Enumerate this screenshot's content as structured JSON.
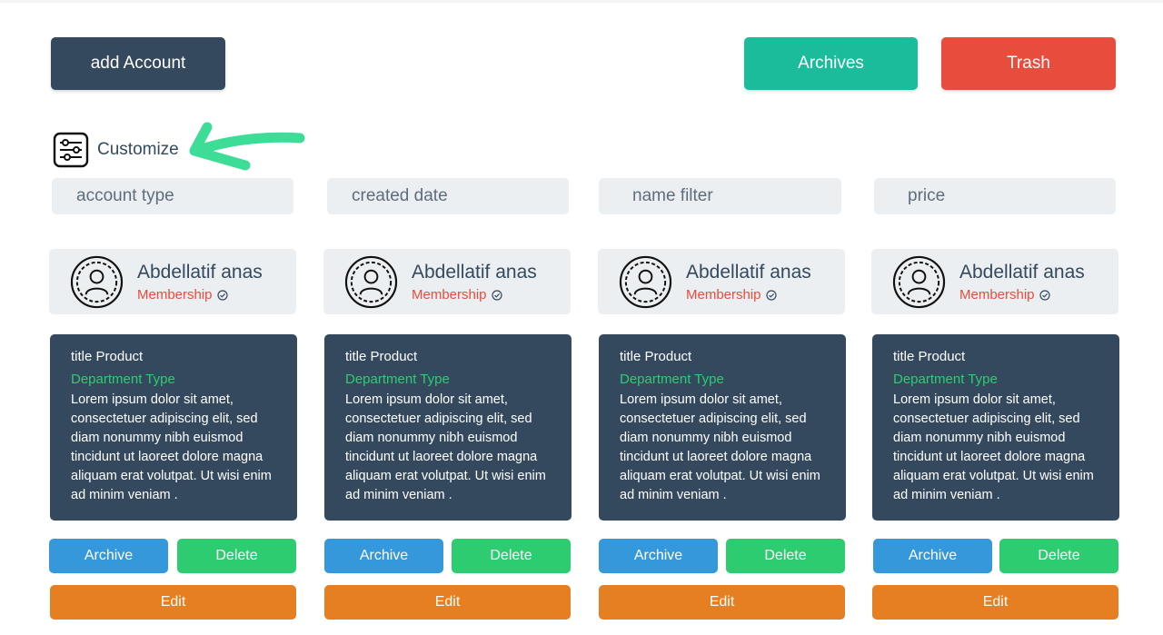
{
  "toolbar": {
    "add_account_label": "add Account",
    "archives_label": "Archives",
    "trash_label": "Trash"
  },
  "customize": {
    "label": "Customize",
    "icon": "sliders-icon"
  },
  "filters": [
    {
      "label": "account type"
    },
    {
      "label": "created date"
    },
    {
      "label": "name filter"
    },
    {
      "label": "price"
    }
  ],
  "cards": [
    {
      "name": "Abdellatif anas",
      "membership": "Membership",
      "title": "title Product",
      "department": "Department Type",
      "description": "Lorem ipsum dolor sit amet, consectetuer adipiscing elit, sed diam nonummy nibh euismod tincidunt ut laoreet dolore magna aliquam erat volutpat. Ut wisi enim ad minim veniam .",
      "archive_label": "Archive",
      "delete_label": "Delete",
      "edit_label": "Edit"
    },
    {
      "name": "Abdellatif anas",
      "membership": "Membership",
      "title": "title Product",
      "department": "Department Type",
      "description": "Lorem ipsum dolor sit amet, consectetuer adipiscing elit, sed diam nonummy nibh euismod tincidunt ut laoreet dolore magna aliquam erat volutpat. Ut wisi enim ad minim veniam .",
      "archive_label": "Archive",
      "delete_label": "Delete",
      "edit_label": "Edit"
    },
    {
      "name": "Abdellatif anas",
      "membership": "Membership",
      "title": "title Product",
      "department": "Department Type",
      "description": "Lorem ipsum dolor sit amet, consectetuer adipiscing elit, sed diam nonummy nibh euismod tincidunt ut laoreet dolore magna aliquam erat volutpat. Ut wisi enim ad minim veniam .",
      "archive_label": "Archive",
      "delete_label": "Delete",
      "edit_label": "Edit"
    },
    {
      "name": "Abdellatif anas",
      "membership": "Membership",
      "title": "title Product",
      "department": "Department Type",
      "description": "Lorem ipsum dolor sit amet, consectetuer adipiscing elit, sed diam nonummy nibh euismod tincidunt ut laoreet dolore magna aliquam erat volutpat. Ut wisi enim ad minim veniam .",
      "archive_label": "Archive",
      "delete_label": "Delete",
      "edit_label": "Edit"
    }
  ],
  "colors": {
    "primary_dark": "#34495e",
    "teal": "#1abc9c",
    "red": "#e74c3c",
    "blue": "#3498db",
    "green": "#2ecc71",
    "orange": "#e67e22",
    "light_gray": "#eceff1",
    "annotation_arrow": "#3ddc97"
  }
}
